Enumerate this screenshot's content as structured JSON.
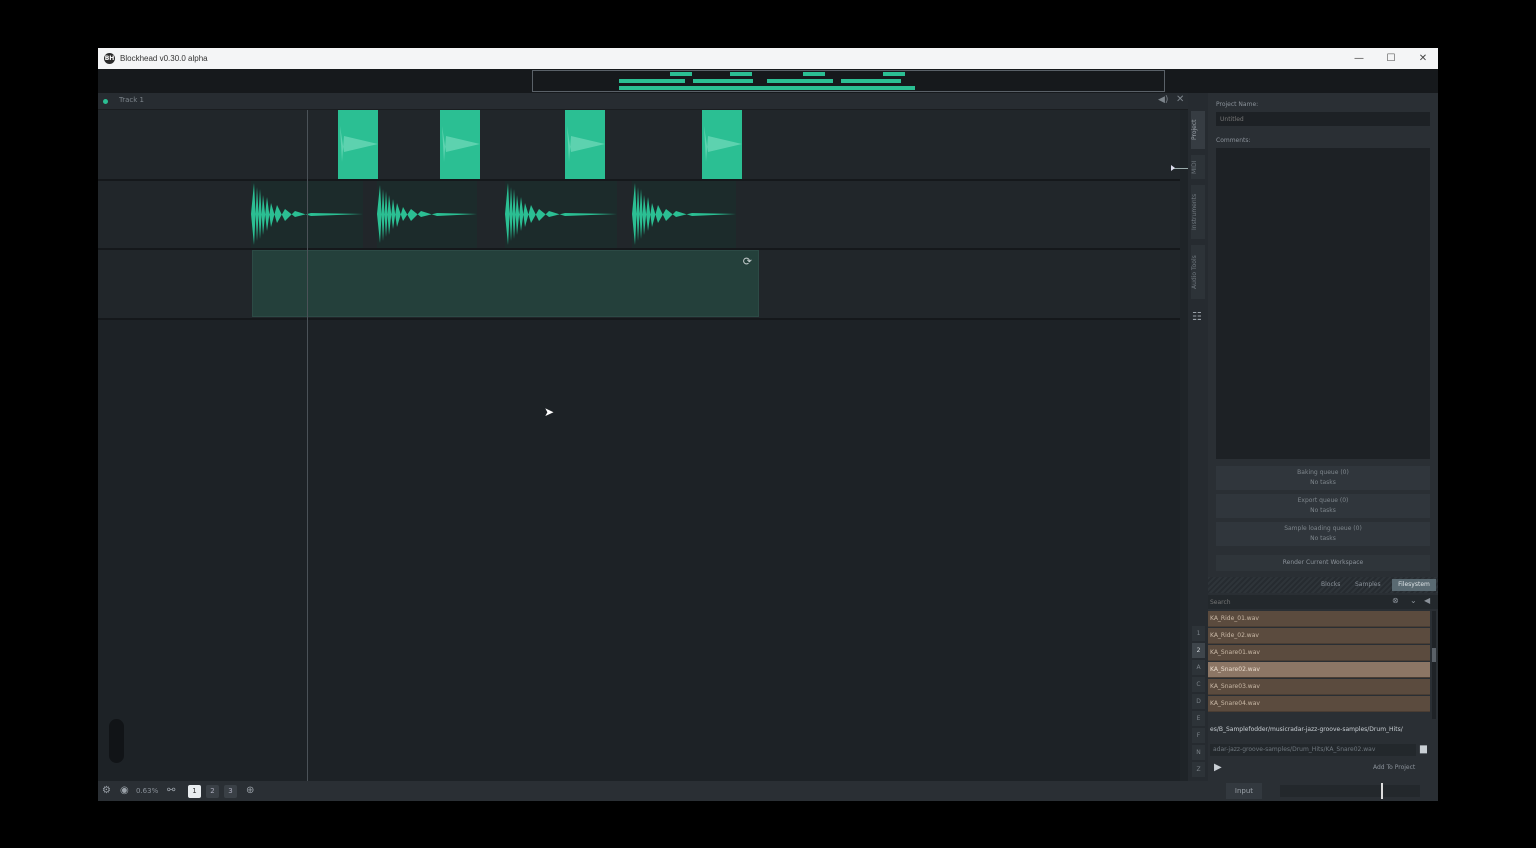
{
  "window": {
    "title": "Blockhead v0.30.0 alpha",
    "logo_text": "BH",
    "minimize_glyph": "—",
    "maximize_glyph": "☐",
    "close_glyph": "✕"
  },
  "track": {
    "name": "Track 1",
    "mute_glyph": "◀)",
    "close_glyph": "✕",
    "loop_glyph": "⟳"
  },
  "bottombar": {
    "zoom": "0.63%",
    "workspace_tabs": [
      "1",
      "2",
      "3"
    ],
    "active_workspace": "1",
    "input_label": "Input"
  },
  "sidetabs": {
    "tabs": [
      "Project",
      "MIDI",
      "Instruments",
      "Audio Tools"
    ],
    "letters": [
      "1",
      "2",
      "A",
      "C",
      "D",
      "E",
      "F",
      "N",
      "Z"
    ],
    "active_letter": "2"
  },
  "panel": {
    "project_name_label": "Project Name:",
    "project_name_placeholder": "Untitled",
    "comments_label": "Comments:",
    "queues": [
      {
        "title": "Baking queue (0)",
        "status": "No tasks"
      },
      {
        "title": "Export queue (0)",
        "status": "No tasks"
      },
      {
        "title": "Sample loading queue (0)",
        "status": "No tasks"
      }
    ],
    "render_label": "Render Current Workspace",
    "browser_tabs": [
      "Blocks",
      "Samples",
      "Filesystem"
    ],
    "active_browser_tab": "Filesystem",
    "search_placeholder": "Search",
    "files": [
      "KA_Ride_01.wav",
      "KA_Ride_02.wav",
      "KA_Snare01.wav",
      "KA_Snare02.wav",
      "KA_Snare03.wav",
      "KA_Snare04.wav"
    ],
    "selected_file": "KA_Snare02.wav",
    "path_full": "es/B_Samplefodder/musicradar-jazz-groove-samples/Drum_Hits/",
    "path_input": "adar-jazz-groove-samples/Drum_Hits/KA_Snare02.wav",
    "add_to_project": "Add To Project"
  },
  "colors": {
    "accent": "#2bbf93",
    "file_row": "#5b4b3e",
    "file_row_selected": "#8c7665"
  }
}
